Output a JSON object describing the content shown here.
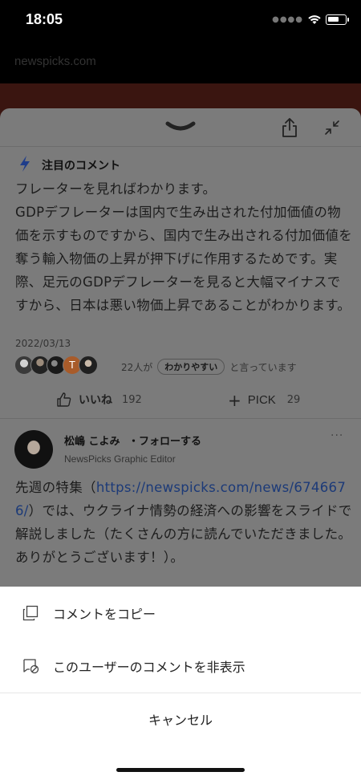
{
  "status": {
    "time": "18:05"
  },
  "browser": {
    "url": "newspicks.com"
  },
  "panel": {
    "section_title": "注目のコメント",
    "comment1": {
      "text": "フレーターを見ればわかります。\nGDPデフレーターは国内で生み出された付加価値の物価を示すものですから、国内で生み出される付加価値を奪う輸入物価の上昇が押下げに作用するためです。実際、足元のGDPデフレーターを見ると大幅マイナスですから、日本は悪い物価上昇であることがわかります。",
      "date": "2022/03/13",
      "helpful_count_text": "22人が",
      "helpful_badge": "わかりやすい",
      "helpful_suffix": "と言っています",
      "like_label": "いいね",
      "like_count": "192",
      "pick_label": "PICK",
      "pick_count": "29"
    },
    "comment2": {
      "author_name": "松嶋 こよみ",
      "follow_label": "・フォローする",
      "author_role": "NewsPicks Graphic Editor",
      "more_label": "···",
      "text_before": "先週の特集（",
      "link": "https://newspicks.com/news/6746676/",
      "text_after": "）では、ウクライナ情勢の経済への影響をスライドで解説しました（たくさんの方に読んでいただきました。ありがとうございます！）。"
    }
  },
  "sheet": {
    "copy_label": "コメントをコピー",
    "hide_label": "このユーザーのコメントを非表示",
    "cancel_label": "キャンセル"
  }
}
